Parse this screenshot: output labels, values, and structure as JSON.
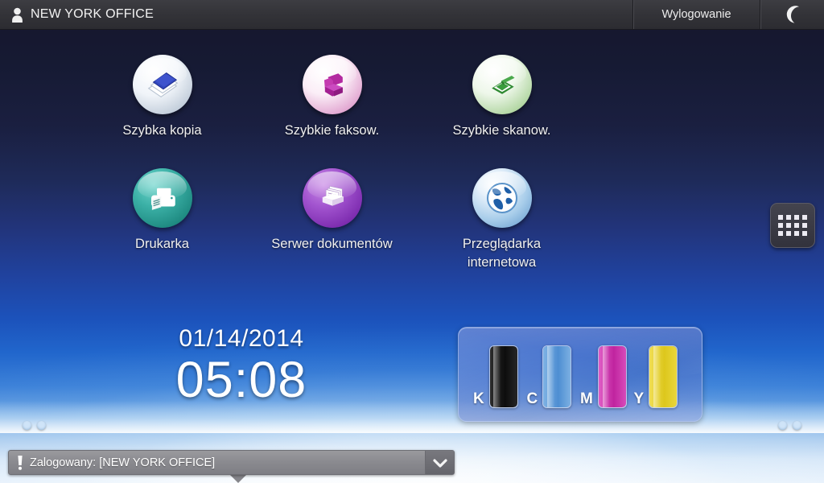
{
  "header": {
    "user_icon": "person-icon",
    "user_name": "NEW YORK OFFICE",
    "logout_label": "Wylogowanie",
    "sleep_icon": "moon-icon"
  },
  "apps": {
    "row1": [
      {
        "label": "Szybka kopia",
        "icon": "quick-copy-icon",
        "disc_color": "#e9eef5",
        "glyph_color": "#2f47b5"
      },
      {
        "label": "Szybkie faksow.",
        "icon": "quick-fax-icon",
        "disc_color": "#e9cfe3",
        "glyph_color": "#a1218f"
      },
      {
        "label": "Szybkie skanow.",
        "icon": "quick-scan-icon",
        "disc_color": "#d8e8cf",
        "glyph_color": "#2f8a32"
      }
    ],
    "row2": [
      {
        "label": "Drukarka",
        "icon": "printer-icon",
        "disc_color": "#2a9790",
        "glyph_color": "#ffffff"
      },
      {
        "label": "Serwer dokumentów",
        "icon": "document-server-icon",
        "disc_color": "#9646c2",
        "glyph_color": "#f2eaf8"
      },
      {
        "label": "Przeglądarka\ninternetowa",
        "icon": "web-browser-icon",
        "disc_color": "#2b6fc4",
        "glyph_color": "#ffffff"
      }
    ]
  },
  "drawer": {
    "icon": "app-grid-icon",
    "dot_count": 12
  },
  "clock": {
    "date": "01/14/2014",
    "time": "05:08"
  },
  "toner": {
    "items": [
      {
        "letter": "K",
        "name": "black",
        "color": "#1b1b1b",
        "level": 100
      },
      {
        "letter": "C",
        "name": "cyan",
        "color": "#5d96d8",
        "level": 100
      },
      {
        "letter": "M",
        "name": "magenta",
        "color": "#cc33aa",
        "level": 100
      },
      {
        "letter": "Y",
        "name": "yellow",
        "color": "#e6d028",
        "level": 100
      }
    ]
  },
  "page_indicator": {
    "left_dots": 2,
    "right_dots": 2
  },
  "statusbar": {
    "alert_icon": "alert-icon",
    "text": "Zalogowany: [NEW YORK OFFICE]",
    "expand_icon": "chevron-down-icon"
  }
}
